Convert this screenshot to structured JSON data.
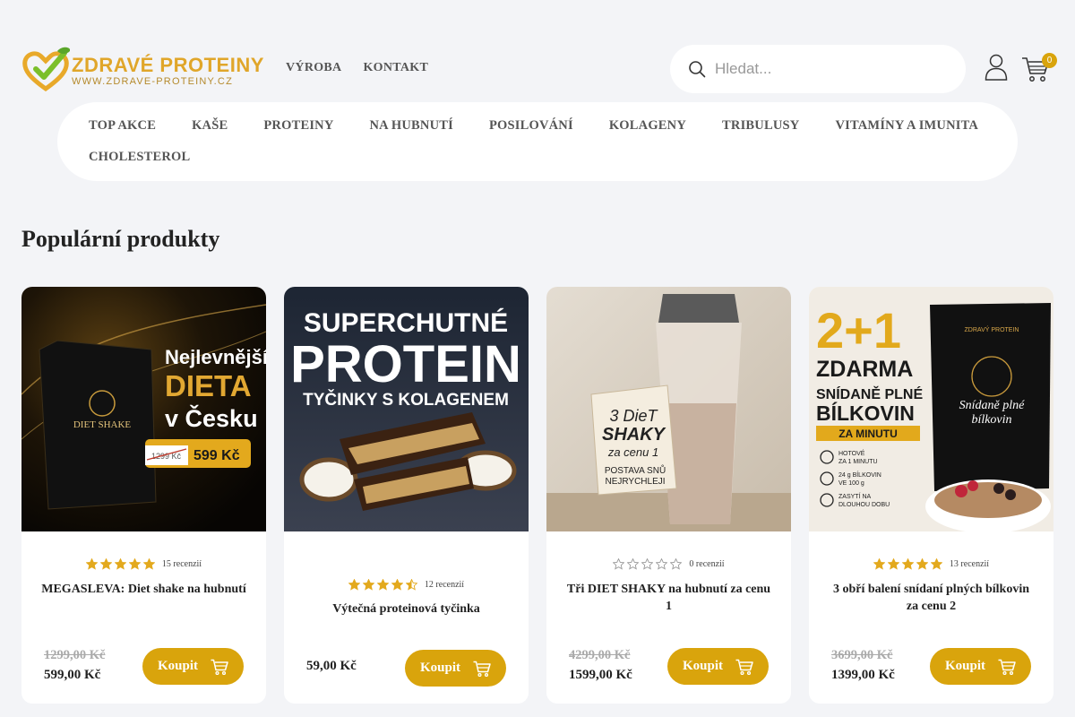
{
  "brand": {
    "name": "ZDRAVÉ PROTEINY",
    "url": "WWW.ZDRAVE-PROTEINY.CZ"
  },
  "topnav": [
    "VÝROBA",
    "KONTAKT"
  ],
  "search": {
    "placeholder": "Hledat..."
  },
  "cart": {
    "count": "0"
  },
  "categories": [
    "TOP AKCE",
    "KAŠE",
    "PROTEINY",
    "NA HUBNUTÍ",
    "POSILOVÁNÍ",
    "KOLAGENY",
    "TRIBULUSY",
    "VITAMÍNY A IMUNITA",
    "CHOLESTEROL"
  ],
  "section_title": "Populární produkty",
  "colors": {
    "accent": "#d9a40c",
    "background": "#f3f4f7"
  },
  "products": [
    {
      "name": "MEGASLEVA: Diet shake na hubnutí",
      "rating": 5,
      "reviews": "15 recenzií",
      "old_price": "1299,00 Kč",
      "price": "599,00 Kč",
      "buy": "Koupit",
      "image": {
        "line1": "Nejlevnější",
        "line2": "DIETA",
        "line3": "v Česku",
        "pack_label": "DIET SHAKE",
        "old_tag": "1299 Kč",
        "new_tag": "599 Kč"
      }
    },
    {
      "name": "Výtečná proteinová tyčinka",
      "rating": 4.5,
      "reviews": "12 recenzií",
      "old_price": "",
      "price": "59,00 Kč",
      "buy": "Koupit",
      "image": {
        "line1": "SUPERCHUTNÉ",
        "line2": "PROTEIN",
        "line3": "TYČINKY S KOLAGENEM"
      }
    },
    {
      "name": "Tři DIET SHAKY na hubnutí za cenu 1",
      "rating": 0,
      "reviews": "0 recenzií",
      "old_price": "4299,00 Kč",
      "price": "1599,00 Kč",
      "buy": "Koupit",
      "image": {
        "line1": "3 DieT",
        "line2": "SHAKY",
        "line3": "za cenu 1",
        "line4": "POSTAVA SNŮ",
        "line5": "NEJRYCHLEJI"
      }
    },
    {
      "name": "3 obří balení snídaní plných bílkovin za cenu 2",
      "rating": 5,
      "reviews": "13 recenzií",
      "old_price": "3699,00 Kč",
      "price": "1399,00 Kč",
      "buy": "Koupit",
      "image": {
        "line1": "2+1",
        "line2": "ZDARMA",
        "line3": "SNÍDANĚ PLNÉ",
        "line4": "BÍLKOVIN",
        "line5": "ZA MINUTU",
        "f1": "HOTOVÉ",
        "f1b": "ZA 1 MINUTU",
        "f2": "24 g BÍLKOVIN",
        "f2b": "VE 100 g",
        "f3": "ZASYTÍ NA",
        "f3b": "DLOUHOU DOBU",
        "pack_brand": "ZDRAVÝ PROTEIN",
        "pack_title1": "Snídaně plné",
        "pack_title2": "bílkovin"
      }
    }
  ]
}
